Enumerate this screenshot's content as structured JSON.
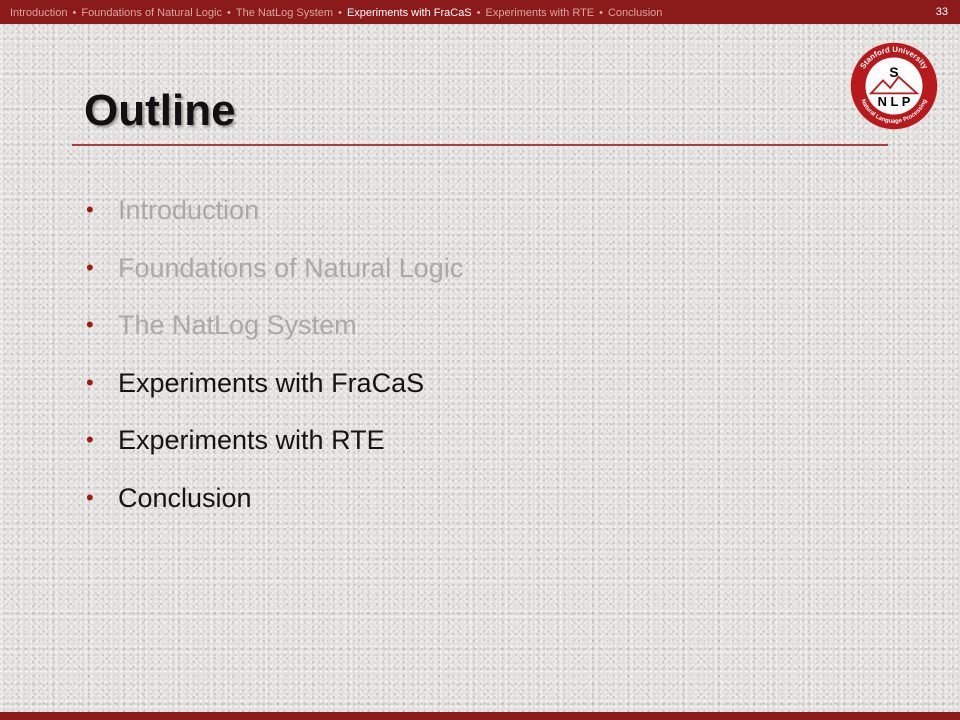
{
  "breadcrumb": {
    "items": [
      {
        "label": "Introduction",
        "active": false
      },
      {
        "label": "Foundations of Natural Logic",
        "active": false
      },
      {
        "label": "The NatLog System",
        "active": false
      },
      {
        "label": "Experiments with FraCaS",
        "active": true
      },
      {
        "label": "Experiments with RTE",
        "active": false
      },
      {
        "label": "Conclusion",
        "active": false
      }
    ],
    "separator": "•"
  },
  "slide_number": "33",
  "logo": {
    "ring_text_top": "Stanford University",
    "ring_text_bottom": "Natural Language Processing",
    "monogram_top": "S",
    "monogram_bottom": "N L P"
  },
  "title": "Outline",
  "outline": {
    "bullet": "•",
    "items": [
      {
        "label": "Introduction",
        "state": "dim"
      },
      {
        "label": "Foundations of Natural Logic",
        "state": "dim"
      },
      {
        "label": "The NatLog System",
        "state": "dim"
      },
      {
        "label": "Experiments with FraCaS",
        "state": "strong"
      },
      {
        "label": "Experiments with RTE",
        "state": "strong"
      },
      {
        "label": "Conclusion",
        "state": "strong"
      }
    ]
  },
  "colors": {
    "brand_red": "#8b1a1a",
    "bullet_red": "#9a1c17",
    "dim_text": "#a9a9a9",
    "strong_text": "#141414"
  }
}
